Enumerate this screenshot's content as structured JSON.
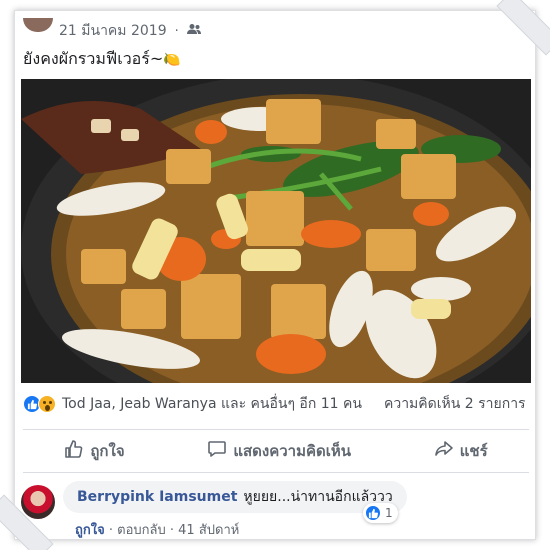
{
  "post": {
    "date": "21 มีนาคม 2019",
    "separator": "·",
    "text": "ยังคงผักรวมฟีเวอร์~",
    "text_emoji": "🍋",
    "privacy_icon": "friends-icon"
  },
  "reactions": {
    "names": "Tod Jaa, Jeab Waranya และ คนอื่นๆ อีก 11 คน",
    "comments": "ความคิดเห็น 2 รายการ"
  },
  "actions": {
    "like_label": "ถูกใจ",
    "comment_label": "แสดงความคิดเห็น",
    "share_label": "แชร์"
  },
  "comment": {
    "author": "Berrypink Iamsumet",
    "text": "หูยยย...น่าทานอีกแล้ววว",
    "like_count": "1",
    "like_link": "ถูกใจ",
    "reply_link": "ตอบกลับ",
    "time": "41 สัปดาห์",
    "dot": "·"
  },
  "colors": {
    "brand_blue": "#1877f2",
    "link_blue": "#385898"
  }
}
